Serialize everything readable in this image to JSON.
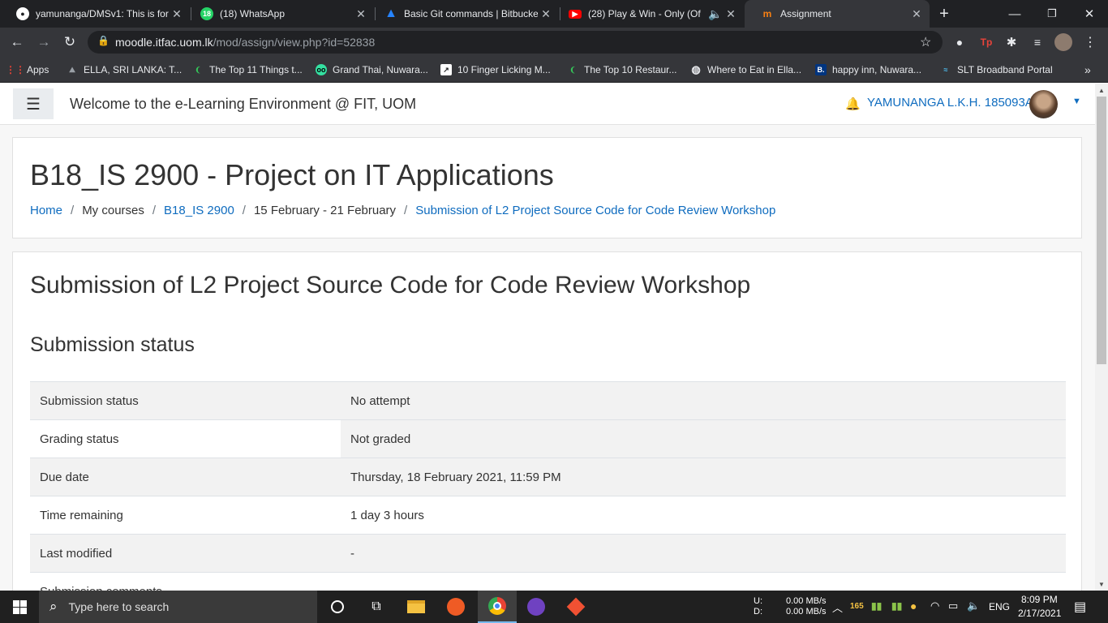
{
  "browser": {
    "tabs": [
      {
        "title": "yamunanga/DMSv1: This is for",
        "icon": "github-icon",
        "color": "#ffffff"
      },
      {
        "title": "(18) WhatsApp",
        "icon": "whatsapp-icon",
        "color": "#25d366"
      },
      {
        "title": "Basic Git commands | Bitbucket",
        "icon": "bitbucket-icon",
        "color": "#2684ff"
      },
      {
        "title": "(28) Play & Win - Only (Of",
        "icon": "youtube-icon",
        "color": "#ff0000"
      },
      {
        "title": "Assignment",
        "icon": "moodle-icon",
        "color": "#f98012"
      }
    ],
    "url_host": "moodle.itfac.uom.lk",
    "url_path": "/mod/assign/view.php?id=52838",
    "bookmarks": [
      "Apps",
      "ELLA, SRI LANKA: T...",
      "The Top 11 Things t...",
      "Grand Thai, Nuwara...",
      "10 Finger Licking M...",
      "The Top 10 Restaur...",
      "Where to Eat in Ella...",
      "happy inn, Nuwara...",
      "SLT Broadband Portal"
    ],
    "bookmarks_overflow": "»",
    "extension_badge": "Tp"
  },
  "site": {
    "title": "Welcome to the e-Learning Environment @ FIT, UOM",
    "user": "YAMUNANGA L.K.H. 185093A"
  },
  "course": {
    "title": "B18_IS 2900 - Project on IT Applications",
    "breadcrumb": [
      {
        "label": "Home",
        "link": true
      },
      {
        "label": "My courses",
        "link": false
      },
      {
        "label": "B18_IS 2900",
        "link": true
      },
      {
        "label": "15 February - 21 February",
        "link": false
      },
      {
        "label": "Submission of L2 Project Source Code for Code Review Workshop",
        "link": true
      }
    ]
  },
  "assignment": {
    "title": "Submission of L2 Project Source Code for Code Review Workshop",
    "status_heading": "Submission status",
    "rows": [
      {
        "key": "Submission status",
        "value": "No attempt"
      },
      {
        "key": "Grading status",
        "value": "Not graded"
      },
      {
        "key": "Due date",
        "value": "Thursday, 18 February 2021, 11:59 PM"
      },
      {
        "key": "Time remaining",
        "value": "1 day 3 hours"
      },
      {
        "key": "Last modified",
        "value": "-"
      },
      {
        "key": "Submission comments",
        "value": ""
      }
    ]
  },
  "taskbar": {
    "search_placeholder": "Type here to search",
    "net_up_label": "U:",
    "net_down_label": "D:",
    "net_up": "0.00 MB/s",
    "net_down": "0.00 MB/s",
    "tray_badge": "165",
    "language": "ENG",
    "time": "8:09 PM",
    "date": "2/17/2021"
  },
  "colors": {
    "link": "#0f6cbf",
    "chrome_dark": "#202124",
    "chrome_toolbar": "#35363a"
  }
}
